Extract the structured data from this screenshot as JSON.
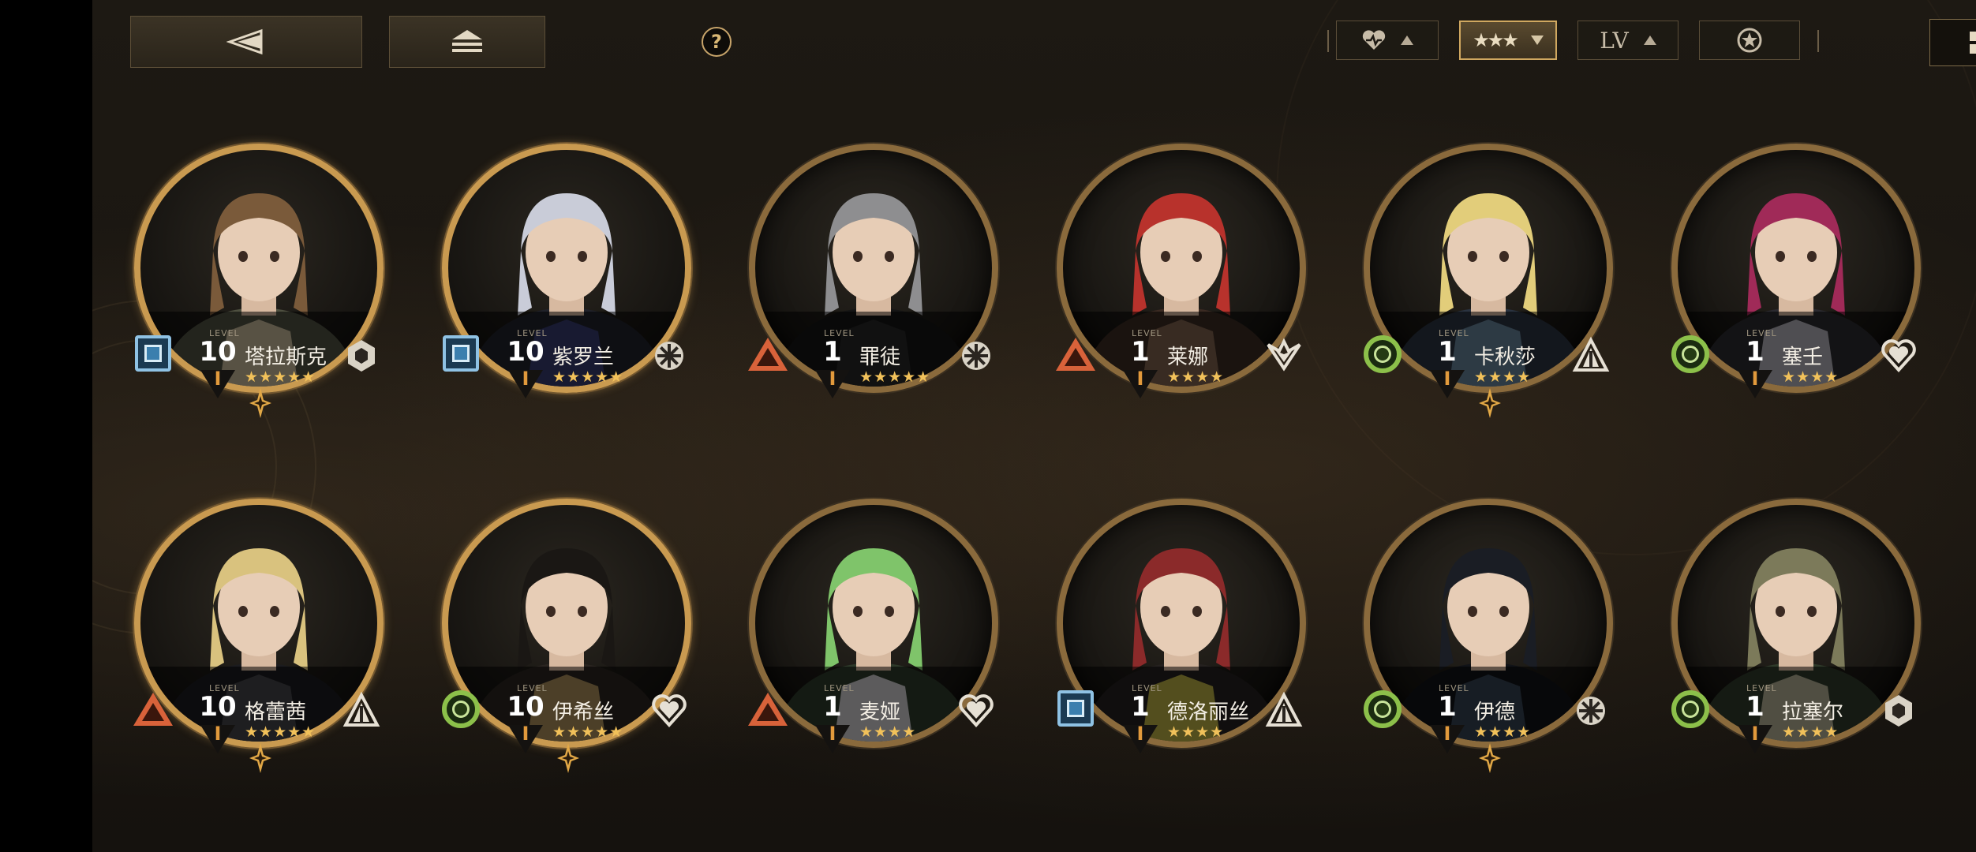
{
  "colors": {
    "accent_gold": "#c99a50",
    "class_blue": "#8fc2e4",
    "class_red": "#d8623a",
    "class_green": "#8cc04a",
    "star": "#f1c15a",
    "rank": "#e29a3c"
  },
  "topbar": {
    "back_icon": "back-arrow-icon",
    "home_icon": "home-stack-icon",
    "help_label": "?"
  },
  "sort": {
    "affinity_icon": "heart-icon",
    "rarity_stars": "★★★",
    "level_label": "LV",
    "role_icon": "star-circle-icon",
    "view_icon": "grid-view-icon"
  },
  "level_caption": "LEVEL",
  "rank_numeral": "I",
  "characters": [
    {
      "name": "塔拉斯克",
      "level": "10",
      "stars": "★★★★★",
      "class": "square",
      "emblem": "hexcluster",
      "gem": true
    },
    {
      "name": "紫罗兰",
      "level": "10",
      "stars": "★★★★★",
      "class": "square",
      "emblem": "snowflake",
      "gem": false
    },
    {
      "name": "罪徒",
      "level": "1",
      "stars": "★★★★★",
      "class": "triangle",
      "emblem": "snowflake",
      "gem": false
    },
    {
      "name": "莱娜",
      "level": "1",
      "stars": "★★★★",
      "class": "triangle",
      "emblem": "wings",
      "gem": false
    },
    {
      "name": "卡秋莎",
      "level": "1",
      "stars": "★★★★",
      "class": "circle",
      "emblem": "spire",
      "gem": true
    },
    {
      "name": "塞壬",
      "level": "1",
      "stars": "★★★★",
      "class": "circle",
      "emblem": "heart",
      "gem": false
    },
    {
      "name": "格蕾茜",
      "level": "10",
      "stars": "★★★★★",
      "class": "triangle",
      "emblem": "spire",
      "gem": true
    },
    {
      "name": "伊希丝",
      "level": "10",
      "stars": "★★★★★",
      "class": "circle",
      "emblem": "heart",
      "gem": true
    },
    {
      "name": "麦娅",
      "level": "1",
      "stars": "★★★★",
      "class": "triangle",
      "emblem": "heart",
      "gem": false
    },
    {
      "name": "德洛丽丝",
      "level": "1",
      "stars": "★★★★",
      "class": "square",
      "emblem": "spire",
      "gem": false
    },
    {
      "name": "伊德",
      "level": "1",
      "stars": "★★★★",
      "class": "circle",
      "emblem": "snowflake",
      "gem": true
    },
    {
      "name": "拉塞尔",
      "level": "1",
      "stars": "★★★★",
      "class": "circle",
      "emblem": "hexcluster",
      "gem": false
    }
  ]
}
